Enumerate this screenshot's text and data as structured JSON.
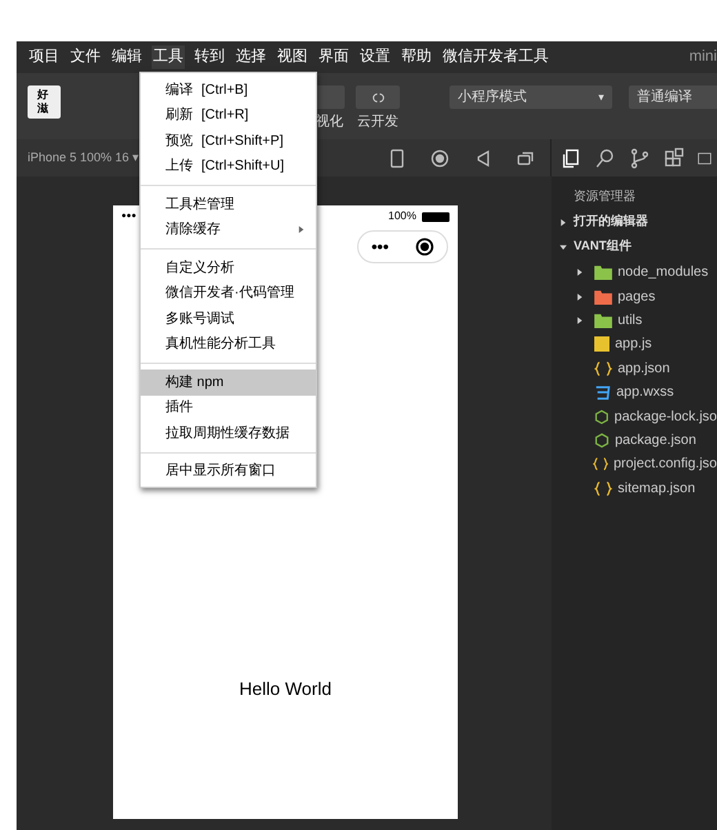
{
  "menu_bar": {
    "items": [
      {
        "label": "项目",
        "selected": false
      },
      {
        "label": "文件",
        "selected": false
      },
      {
        "label": "编辑",
        "selected": false
      },
      {
        "label": "工具",
        "selected": true
      },
      {
        "label": "转到",
        "selected": false
      },
      {
        "label": "选择",
        "selected": false
      },
      {
        "label": "视图",
        "selected": false
      },
      {
        "label": "界面",
        "selected": false
      },
      {
        "label": "设置",
        "selected": false
      },
      {
        "label": "帮助",
        "selected": false
      },
      {
        "label": "微信开发者工具",
        "selected": false
      }
    ],
    "title": "mini"
  },
  "toolbar": {
    "logo": "好滋",
    "buttons": [
      {
        "label": "视化"
      },
      {
        "label": "云开发"
      }
    ],
    "mode_select": {
      "value": "小程序模式",
      "caret": "▾"
    },
    "compile_select": {
      "value": "普通编译"
    }
  },
  "tools_menu": {
    "groups": [
      [
        {
          "label": "编译",
          "shortcut": "[Ctrl+B]",
          "selected": false,
          "submenu": false
        },
        {
          "label": "刷新",
          "shortcut": "[Ctrl+R]",
          "selected": false,
          "submenu": false
        },
        {
          "label": "预览",
          "shortcut": "[Ctrl+Shift+P]",
          "selected": false,
          "submenu": false
        },
        {
          "label": "上传",
          "shortcut": "[Ctrl+Shift+U]",
          "selected": false,
          "submenu": false
        }
      ],
      [
        {
          "label": "工具栏管理",
          "selected": false,
          "submenu": false
        },
        {
          "label": "清除缓存",
          "selected": false,
          "submenu": true
        }
      ],
      [
        {
          "label": "自定义分析",
          "selected": false,
          "submenu": false
        },
        {
          "label": "微信开发者·代码管理",
          "selected": false,
          "submenu": false
        },
        {
          "label": "多账号调试",
          "selected": false,
          "submenu": false
        },
        {
          "label": "真机性能分析工具",
          "selected": false,
          "submenu": false
        }
      ],
      [
        {
          "label": "构建 npm",
          "selected": true,
          "submenu": false
        },
        {
          "label": "插件",
          "selected": false,
          "submenu": false
        },
        {
          "label": "拉取周期性缓存数据",
          "selected": false,
          "submenu": false
        }
      ],
      [
        {
          "label": "居中显示所有窗口",
          "selected": false,
          "submenu": false
        }
      ]
    ]
  },
  "simulator": {
    "device": "iPhone 5 100% 16 ▾",
    "status_dots": "●●●",
    "battery_text": "100%",
    "capsule_dots": "•••",
    "content": "Hello World"
  },
  "explorer": {
    "title": "资源管理器",
    "sections": [
      {
        "label": "打开的编辑器",
        "expanded": false
      },
      {
        "label": "VANT组件",
        "expanded": true
      }
    ],
    "files": [
      {
        "name": "node_modules",
        "kind": "folder",
        "color": "#8bc34a",
        "expanded": false
      },
      {
        "name": "pages",
        "kind": "folder",
        "color": "#ef6c4a",
        "expanded": false
      },
      {
        "name": "utils",
        "kind": "folder",
        "color": "#8bc34a",
        "expanded": false
      },
      {
        "name": "app.js",
        "kind": "js"
      },
      {
        "name": "app.json",
        "kind": "json"
      },
      {
        "name": "app.wxss",
        "kind": "css"
      },
      {
        "name": "package-lock.jso",
        "kind": "node"
      },
      {
        "name": "package.json",
        "kind": "node"
      },
      {
        "name": "project.config.jso",
        "kind": "json"
      },
      {
        "name": "sitemap.json",
        "kind": "json"
      }
    ]
  }
}
